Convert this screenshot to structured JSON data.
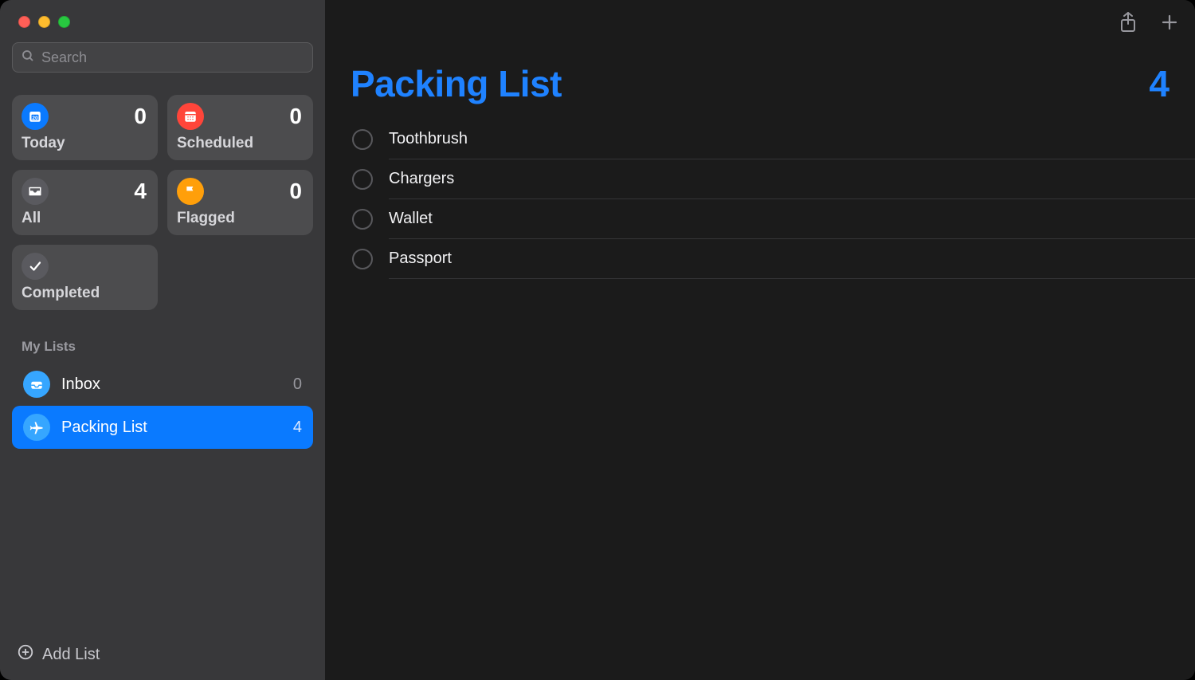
{
  "search": {
    "placeholder": "Search"
  },
  "smart": {
    "today": {
      "label": "Today",
      "count": "0"
    },
    "scheduled": {
      "label": "Scheduled",
      "count": "0"
    },
    "all": {
      "label": "All",
      "count": "4"
    },
    "flagged": {
      "label": "Flagged",
      "count": "0"
    },
    "completed": {
      "label": "Completed"
    }
  },
  "mylists": {
    "header": "My Lists",
    "items": [
      {
        "name": "Inbox",
        "count": "0"
      },
      {
        "name": "Packing List",
        "count": "4"
      }
    ]
  },
  "addList": "Add List",
  "main": {
    "title": "Packing List",
    "count": "4",
    "items": [
      {
        "title": "Toothbrush"
      },
      {
        "title": "Chargers"
      },
      {
        "title": "Wallet"
      },
      {
        "title": "Passport"
      }
    ]
  }
}
